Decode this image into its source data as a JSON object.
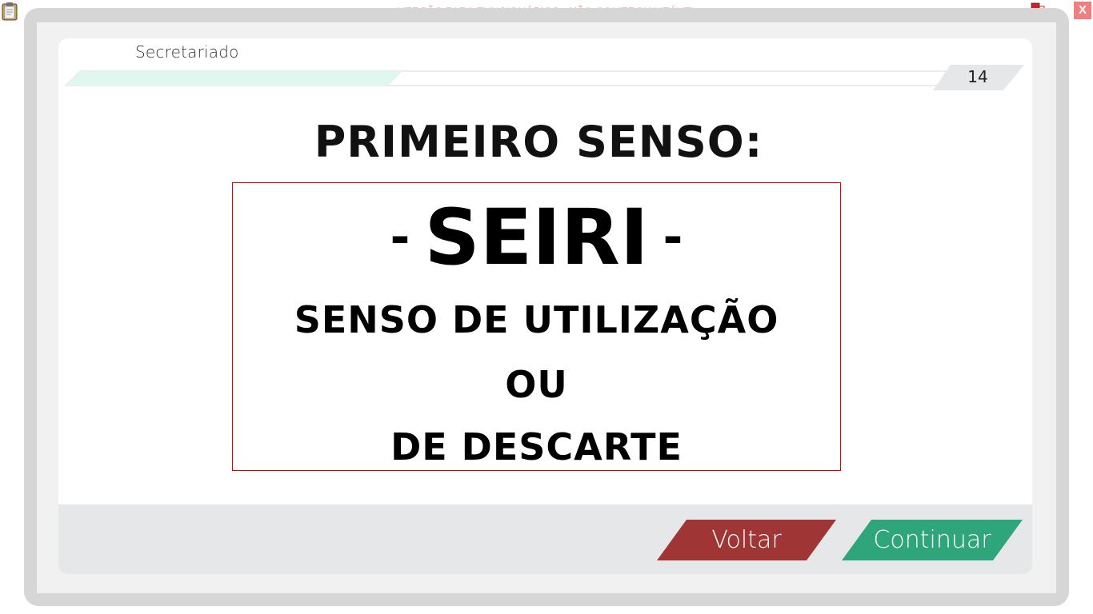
{
  "window": {
    "watermark": "VERSÃO PARA FUNCIONÁRIOS - NÃO COMERCIALIZÁVEL",
    "close_label": "X",
    "app_icon": "clipboard-icon",
    "status_icon": "network-status-icon"
  },
  "header": {
    "course_title": "Secretariado",
    "page_number": "14",
    "progress": 0.37,
    "progress_color": "#dff7ee"
  },
  "slide": {
    "heading": "PRIMEIRO SENSO:",
    "term_dash_left": "-",
    "term": "SEIRI",
    "term_dash_right": "-",
    "meaning": [
      "SENSO DE UTILIZAÇÃO",
      "OU",
      "DE DESCARTE"
    ],
    "box_border_color": "#d40000"
  },
  "footer": {
    "back_label": "Voltar",
    "next_label": "Continuar",
    "back_color": "#a03535",
    "next_color": "#2ea57a"
  }
}
